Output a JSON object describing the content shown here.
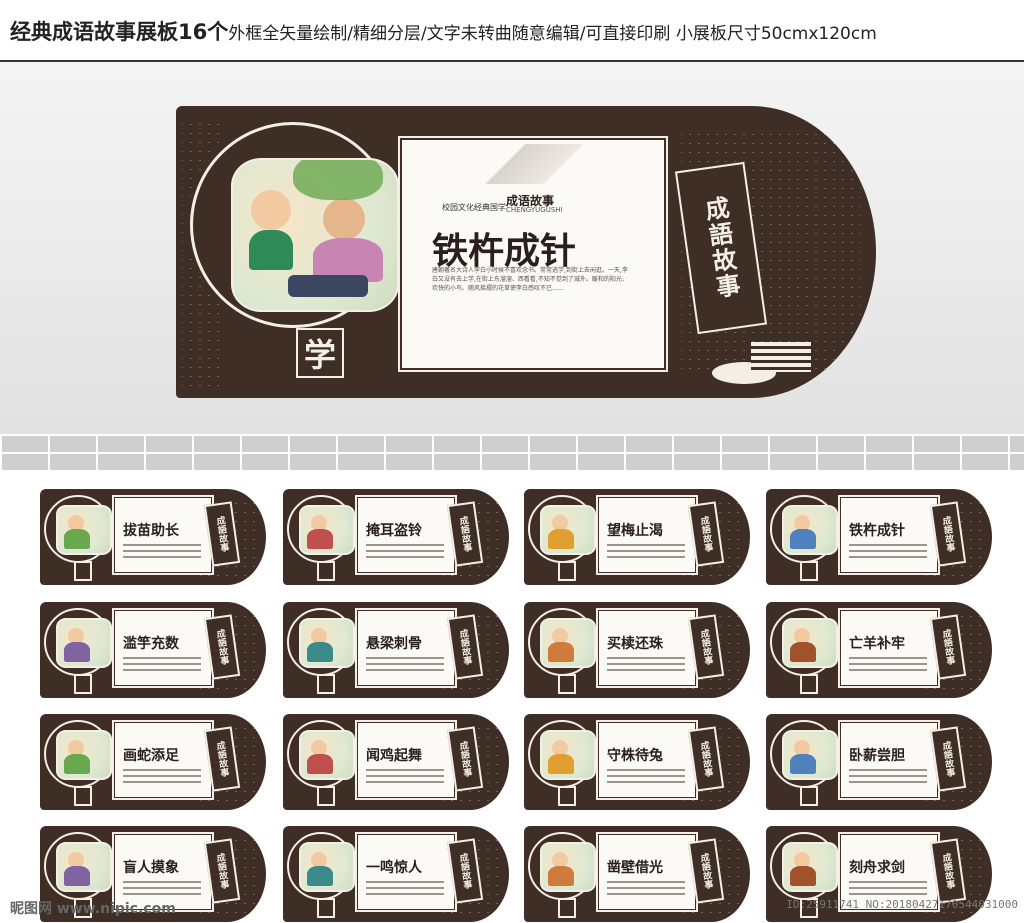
{
  "header": {
    "title": "经典成语故事展板16个",
    "subtitle": "外框全矢量绘制/精细分层/文字未转曲随意编辑/可直接印刷 小展板尺寸50cmx120cm"
  },
  "hero": {
    "title": "铁杵成针",
    "header_small": "成语故事",
    "header_pinyin": "CHENGYUGUSHI",
    "school_label": "校园文化经典国学",
    "seal": "学",
    "tag": "成語故事",
    "body_text": "唐朝著名大诗人李白小时候不喜欢念书。常常逃学,到街上去闲逛。一天,李白又没有去上学,在街上东溜溜、西看看,不知不觉到了城外。暖和的阳光、欢快的小鸟、随风摇摆的花草使李白感叹不已……"
  },
  "boards": [
    {
      "title": "拔苗助长"
    },
    {
      "title": "掩耳盗铃"
    },
    {
      "title": "望梅止渴"
    },
    {
      "title": "铁杵成针"
    },
    {
      "title": "滥竽充数"
    },
    {
      "title": "悬梁刺骨"
    },
    {
      "title": "买椟还珠"
    },
    {
      "title": "亡羊补牢"
    },
    {
      "title": "画蛇添足"
    },
    {
      "title": "闻鸡起舞"
    },
    {
      "title": "守株待兔"
    },
    {
      "title": "卧薪尝胆"
    },
    {
      "title": "盲人摸象"
    },
    {
      "title": "一鸣惊人"
    },
    {
      "title": "凿壁借光"
    },
    {
      "title": "刻舟求剑"
    }
  ],
  "board_tag": "成語故事",
  "watermark": {
    "left": "昵图网 www.nipic.com",
    "right": "ID:25911741 NO:20180427170544031000"
  },
  "colors": {
    "frame": "#3e2e25",
    "panel": "#fbfaf7",
    "cream": "#f3efe6"
  }
}
